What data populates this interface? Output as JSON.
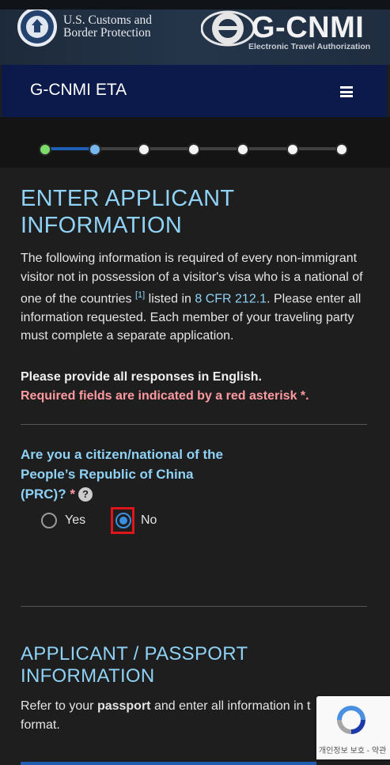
{
  "header": {
    "agency_line1": "U.S. Customs and",
    "agency_line2": "Border Protection",
    "brand_title": "G-CNMI",
    "brand_subtitle": "Electronic Travel Authorization"
  },
  "navbar": {
    "title": "G-CNMI ETA",
    "menu_icon": "hamburger-menu-icon"
  },
  "progress": {
    "total_steps": 7,
    "completed_steps": 1,
    "current_step": 2,
    "colors": {
      "done": "#7edc6a",
      "current": "#76b7f0",
      "pending": "#f4f4f4"
    }
  },
  "section1": {
    "heading_line1": "ENTER APPLICANT",
    "heading_line2": "INFORMATION",
    "intro_part1": "The following information is required of every non-immigrant visitor not in possession of a visitor's visa who is a national of one of the countries ",
    "footnote": "[1]",
    "intro_part2": " listed in ",
    "regulation_link": "8 CFR 212.1",
    "intro_part3": ". Please enter all information requested. Each member of your traveling party must complete a separate application.",
    "english_note": "Please provide all responses in English.",
    "required_note": "Required fields are indicated by a red asterisk *."
  },
  "question": {
    "label": "Are you a citizen/national of the People’s Republic of China (PRC)?",
    "asterisk": "*",
    "help_icon": "?",
    "options": [
      {
        "label": "Yes",
        "selected": false
      },
      {
        "label": "No",
        "selected": true
      }
    ]
  },
  "section2": {
    "heading_line1": "APPLICANT / PASSPORT",
    "heading_line2": "INFORMATION",
    "text_before": "Refer to your ",
    "text_bold": "passport",
    "text_after": " and enter all information in t",
    "text_line2": "format."
  },
  "recaptcha": {
    "icon": "recaptcha-icon",
    "footer": "개인정보 보호 - 약관"
  }
}
